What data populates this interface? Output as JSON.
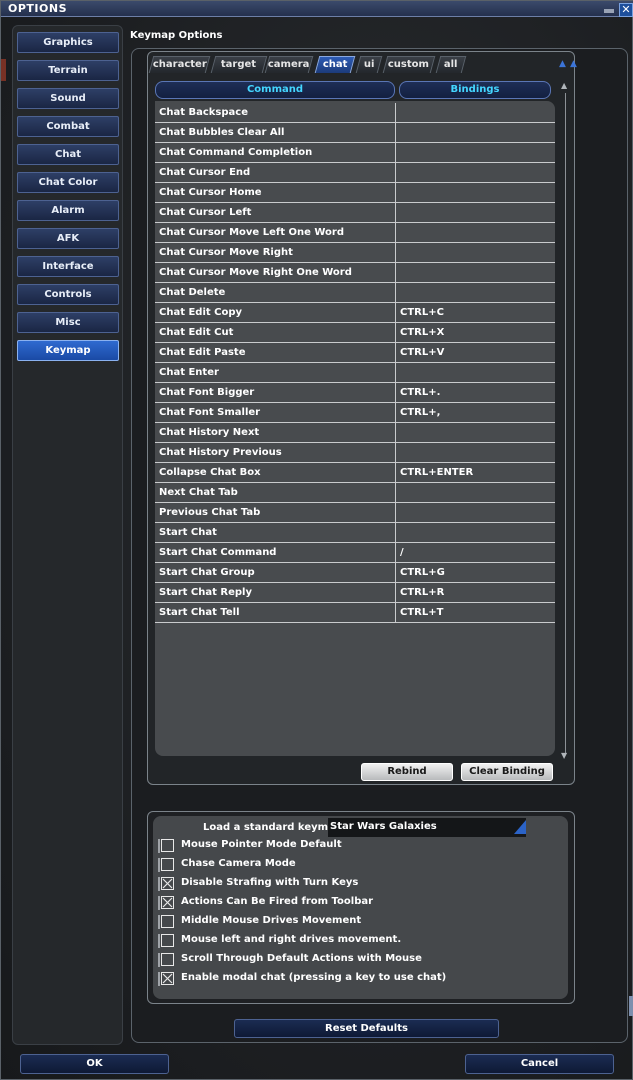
{
  "window": {
    "title": "OPTIONS",
    "close_label": "✕"
  },
  "sidebar": {
    "items": [
      {
        "label": "Graphics",
        "name": "sidebar-item-graphics",
        "active": false
      },
      {
        "label": "Terrain",
        "name": "sidebar-item-terrain",
        "active": false
      },
      {
        "label": "Sound",
        "name": "sidebar-item-sound",
        "active": false
      },
      {
        "label": "Combat",
        "name": "sidebar-item-combat",
        "active": false
      },
      {
        "label": "Chat",
        "name": "sidebar-item-chat",
        "active": false
      },
      {
        "label": "Chat Color",
        "name": "sidebar-item-chat-color",
        "active": false
      },
      {
        "label": "Alarm",
        "name": "sidebar-item-alarm",
        "active": false
      },
      {
        "label": "AFK",
        "name": "sidebar-item-afk",
        "active": false
      },
      {
        "label": "Interface",
        "name": "sidebar-item-interface",
        "active": false
      },
      {
        "label": "Controls",
        "name": "sidebar-item-controls",
        "active": false
      },
      {
        "label": "Misc",
        "name": "sidebar-item-misc",
        "active": false
      },
      {
        "label": "Keymap",
        "name": "sidebar-item-keymap",
        "active": true
      }
    ]
  },
  "main": {
    "title": "Keymap Options",
    "tabs": [
      {
        "label": "character",
        "active": false
      },
      {
        "label": "target",
        "active": false
      },
      {
        "label": "camera",
        "active": false
      },
      {
        "label": "chat",
        "active": true
      },
      {
        "label": "ui",
        "active": false
      },
      {
        "label": "custom",
        "active": false
      },
      {
        "label": "all",
        "active": false
      }
    ],
    "table": {
      "headers": {
        "command": "Command",
        "bindings": "Bindings"
      },
      "rows": [
        {
          "command": "Chat Backspace",
          "binding": ""
        },
        {
          "command": "Chat Bubbles Clear All",
          "binding": ""
        },
        {
          "command": "Chat Command Completion",
          "binding": ""
        },
        {
          "command": "Chat Cursor End",
          "binding": ""
        },
        {
          "command": "Chat Cursor Home",
          "binding": ""
        },
        {
          "command": "Chat Cursor Left",
          "binding": ""
        },
        {
          "command": "Chat Cursor Move Left One Word",
          "binding": ""
        },
        {
          "command": "Chat Cursor Move Right",
          "binding": ""
        },
        {
          "command": "Chat Cursor Move Right One Word",
          "binding": ""
        },
        {
          "command": "Chat Delete",
          "binding": ""
        },
        {
          "command": "Chat Edit Copy",
          "binding": "CTRL+C"
        },
        {
          "command": "Chat Edit Cut",
          "binding": "CTRL+X"
        },
        {
          "command": "Chat Edit Paste",
          "binding": "CTRL+V"
        },
        {
          "command": "Chat Enter",
          "binding": ""
        },
        {
          "command": "Chat Font Bigger",
          "binding": "CTRL+."
        },
        {
          "command": "Chat Font Smaller",
          "binding": "CTRL+,"
        },
        {
          "command": "Chat History Next",
          "binding": ""
        },
        {
          "command": "Chat History Previous",
          "binding": ""
        },
        {
          "command": "Collapse Chat Box",
          "binding": "CTRL+ENTER"
        },
        {
          "command": "Next Chat Tab",
          "binding": ""
        },
        {
          "command": "Previous Chat Tab",
          "binding": ""
        },
        {
          "command": "Start Chat",
          "binding": ""
        },
        {
          "command": "Start Chat Command",
          "binding": "/"
        },
        {
          "command": "Start Chat Group",
          "binding": "CTRL+G"
        },
        {
          "command": "Start Chat Reply",
          "binding": "CTRL+R"
        },
        {
          "command": "Start Chat Tell",
          "binding": "CTRL+T"
        }
      ]
    },
    "rebind_label": "Rebind",
    "clear_binding_label": "Clear Binding"
  },
  "keymap_options": {
    "load_label": "Load a standard keymap:",
    "selected_keymap": "Star Wars Galaxies",
    "checkboxes": [
      {
        "label": "Mouse Pointer Mode Default",
        "checked": false
      },
      {
        "label": "Chase Camera Mode",
        "checked": false
      },
      {
        "label": "Disable Strafing with Turn Keys",
        "checked": true
      },
      {
        "label": "Actions Can Be Fired from Toolbar",
        "checked": true
      },
      {
        "label": "Middle Mouse Drives Movement",
        "checked": false
      },
      {
        "label": "Mouse left and right drives movement.",
        "checked": false
      },
      {
        "label": "Scroll Through Default Actions with Mouse",
        "checked": false
      },
      {
        "label": "Enable modal chat (pressing a key to use chat)",
        "checked": true
      }
    ]
  },
  "footer": {
    "reset_label": "Reset Defaults",
    "ok_label": "OK",
    "cancel_label": "Cancel"
  },
  "colors": {
    "accent_blue": "#2f6ad0",
    "header_text": "#44d6ff",
    "panel_grey": "#484b4e"
  }
}
